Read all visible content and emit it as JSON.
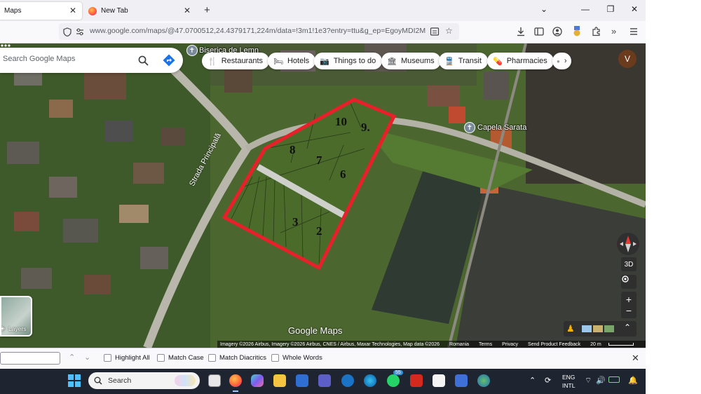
{
  "browser": {
    "tabs": [
      {
        "label": "Maps",
        "active": true
      },
      {
        "label": "New Tab",
        "active": false
      }
    ],
    "url": "www.google.com/maps/@47.0700512,24.4379171,224m/data=!3m1!1e3?entry=ttu&g_ep=EgoyMDI2MDUx"
  },
  "maps": {
    "search_placeholder": "Search Google Maps",
    "chips": [
      {
        "label": "Restaurants",
        "icon": "fork-knife-icon"
      },
      {
        "label": "Hotels",
        "icon": "bed-icon"
      },
      {
        "label": "Things to do",
        "icon": "camera-icon"
      },
      {
        "label": "Museums",
        "icon": "museum-icon"
      },
      {
        "label": "Transit",
        "icon": "train-icon"
      },
      {
        "label": "Pharmacies",
        "icon": "pharmacy-icon"
      }
    ],
    "avatar_initial": "V",
    "places": {
      "church_wood": "Biserica de Lemn",
      "chapel": "Capela Sarata"
    },
    "street_label": "Strada Principală",
    "lot_numbers": [
      "10",
      "9.",
      "8",
      "7",
      "6",
      "3",
      "2"
    ],
    "layers_label": "Layers",
    "controls": {
      "tilt": "3D"
    },
    "logo": "Google Maps",
    "attribution": "Imagery ©2026 Airbus, Imagery ©2026 Airbus, CNES / Airbus, Maxar Technologies, Map data ©2026",
    "footer_links": [
      "Romania",
      "Terms",
      "Privacy",
      "Send Product Feedback"
    ],
    "scale": "20 m"
  },
  "findbar": {
    "options": [
      "Highlight All",
      "Match Case",
      "Match Diacritics",
      "Whole Words"
    ]
  },
  "taskbar": {
    "search_placeholder": "Search",
    "whatsapp_badge": "55",
    "lang_top": "ENG",
    "lang_bottom": "INTL"
  },
  "colors": {
    "plot_outline": "#e8202a",
    "divider": "#cfd0cc",
    "accent_blue": "#1a73e8"
  }
}
